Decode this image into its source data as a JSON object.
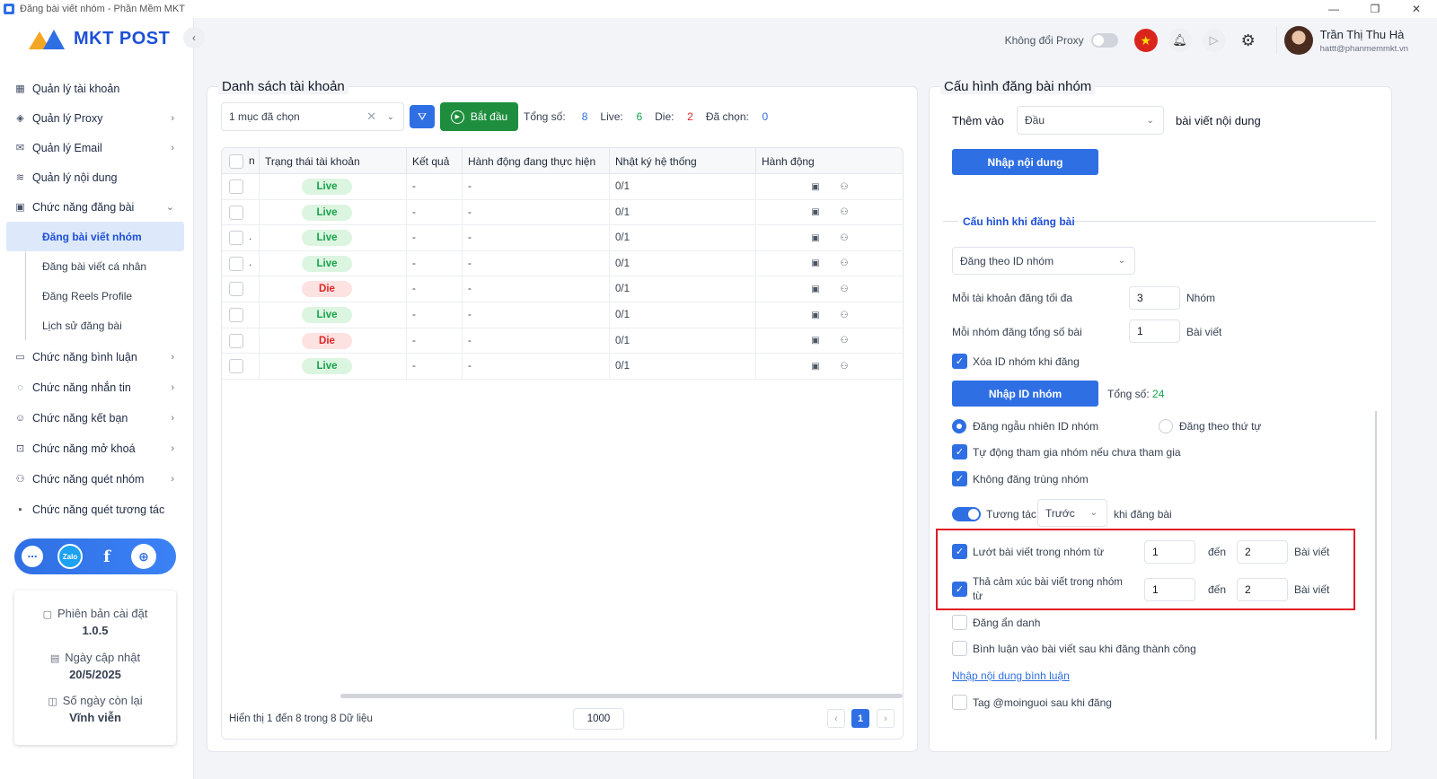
{
  "window": {
    "title": "Đăng bài viết nhóm - Phần Mềm MKT",
    "controls": [
      "—",
      "❐",
      "✕"
    ]
  },
  "logo": {
    "text": "MKT POST"
  },
  "sidebar": {
    "items": [
      {
        "label": "Quản lý tài khoản",
        "icon": "grid-icon",
        "glyph": "▦",
        "chevron": ""
      },
      {
        "label": "Quản lý Proxy",
        "icon": "layers-icon",
        "glyph": "◈",
        "chevron": "›"
      },
      {
        "label": "Quản lý Email",
        "icon": "mail-icon",
        "glyph": "✉",
        "chevron": "›"
      },
      {
        "label": "Quản lý nội dung",
        "icon": "content-icon",
        "glyph": "≋",
        "chevron": ""
      },
      {
        "label": "Chức năng đăng bài",
        "icon": "post-icon",
        "glyph": "▣",
        "chevron": "⌄"
      }
    ],
    "sub_items": [
      {
        "label": "Đăng bài viết nhóm"
      },
      {
        "label": "Đăng bài viết cá nhân"
      },
      {
        "label": "Đăng Reels Profile"
      },
      {
        "label": "Lịch sử đăng bài"
      }
    ],
    "items_after": [
      {
        "label": "Chức năng bình luận",
        "glyph": "▭",
        "chevron": "›"
      },
      {
        "label": "Chức năng nhắn tin",
        "glyph": "◌",
        "chevron": "›"
      },
      {
        "label": "Chức năng kết bạn",
        "glyph": "☺",
        "chevron": "›"
      },
      {
        "label": "Chức năng mở khoá",
        "glyph": "⊡",
        "chevron": "›"
      },
      {
        "label": "Chức năng quét nhóm",
        "glyph": "⚇",
        "chevron": "›"
      },
      {
        "label": "Chức năng quét tương tác",
        "glyph": "▪",
        "chevron": ""
      }
    ],
    "social": {
      "s1": "⋯",
      "s2": "Zalo",
      "s3": "f",
      "s4": "⊕"
    },
    "info": {
      "version_label": "Phiên bản cài đặt",
      "version_value": "1.0.5",
      "update_label": "Ngày cập nhật",
      "update_value": "20/5/2025",
      "days_label": "Số ngày còn lại",
      "days_value": "Vĩnh viễn"
    }
  },
  "header": {
    "proxy_label": "Không đổi Proxy",
    "user_name": "Trần Thị Thu Hà",
    "user_email": "hattt@phanmemmkt.vn"
  },
  "accounts_panel": {
    "title": "Danh sách tài khoản",
    "selector_value": "1 mục đã chọn",
    "start_label": "Bắt đầu",
    "stats": {
      "total_label": "Tổng số:",
      "total": "8",
      "live_label": "Live:",
      "live": "6",
      "die_label": "Die:",
      "die": "2",
      "selected_label": "Đã chọn:",
      "selected": "0"
    },
    "columns": [
      "n",
      "Trạng thái tài khoản",
      "Kết quả",
      "Hành động đang thực hiện",
      "Nhật ký hệ thống",
      "Hành động"
    ],
    "rows": [
      {
        "status": "Live",
        "result": "-",
        "action": "-",
        "log": "0/1",
        "mark": ""
      },
      {
        "status": "Live",
        "result": "-",
        "action": "-",
        "log": "0/1",
        "mark": ""
      },
      {
        "status": "Live",
        "result": "-",
        "action": "-",
        "log": "0/1",
        "mark": "."
      },
      {
        "status": "Live",
        "result": "-",
        "action": "-",
        "log": "0/1",
        "mark": "."
      },
      {
        "status": "Die",
        "result": "-",
        "action": "-",
        "log": "0/1",
        "mark": ""
      },
      {
        "status": "Live",
        "result": "-",
        "action": "-",
        "log": "0/1",
        "mark": ""
      },
      {
        "status": "Die",
        "result": "-",
        "action": "-",
        "log": "0/1",
        "mark": ""
      },
      {
        "status": "Live",
        "result": "-",
        "action": "-",
        "log": "0/1",
        "mark": ""
      }
    ],
    "footer_text": "Hiển thị 1 đến 8 trong 8 Dữ liệu",
    "page_size": "1000",
    "current_page": "1"
  },
  "config_panel": {
    "title": "Cấu hình đăng bài nhóm",
    "add_label": "Thêm vào",
    "position_value": "Đầu",
    "content_suffix": "bài viết nội dung",
    "import_content_btn": "Nhập nội dung",
    "section_title": "Cấu hình khi đăng bài",
    "post_by_value": "Đăng theo ID nhóm",
    "max_per_account_label": "Mỗi tài khoản đăng tối đa",
    "max_per_account": "3",
    "max_per_account_unit": "Nhóm",
    "posts_per_group_label": "Mỗi nhóm đăng tổng số bài",
    "posts_per_group": "1",
    "posts_per_group_unit": "Bài viết",
    "delete_group_label": "Xóa ID nhóm khi đăng",
    "import_group_btn": "Nhập ID nhóm",
    "total_label": "Tổng số:",
    "total_value": "24",
    "random_label": "Đăng ngẫu nhiên ID nhóm",
    "sequential_label": "Đăng theo thứ tự",
    "auto_join_label": "Tự động tham gia nhóm nếu chưa tham gia",
    "no_duplicate_label": "Không đăng trùng nhóm",
    "interact_label": "Tương tác",
    "interact_when": "Trước",
    "interact_suffix": "khi đăng bài",
    "scroll_label": "Lướt bài viết trong nhóm từ",
    "scroll_from": "1",
    "scroll_to": "2",
    "react_label": "Thả cảm xúc bài viết trong nhóm từ",
    "react_from": "1",
    "react_to": "2",
    "to_label": "đến",
    "posts_unit": "Bài viết",
    "anonymous_label": "Đăng ẩn danh",
    "comment_label": "Bình luận vào bài viết sau khi đăng thành công",
    "comment_link": "Nhập nội dung bình luận",
    "tag_label": "Tag @moinguoi sau khi đăng"
  },
  "colors": {
    "accent": "#2f6fe4",
    "start_button": "#1e8e3e",
    "live": "#16a34a",
    "die": "#dc2626",
    "highlight": "#e01b24"
  }
}
